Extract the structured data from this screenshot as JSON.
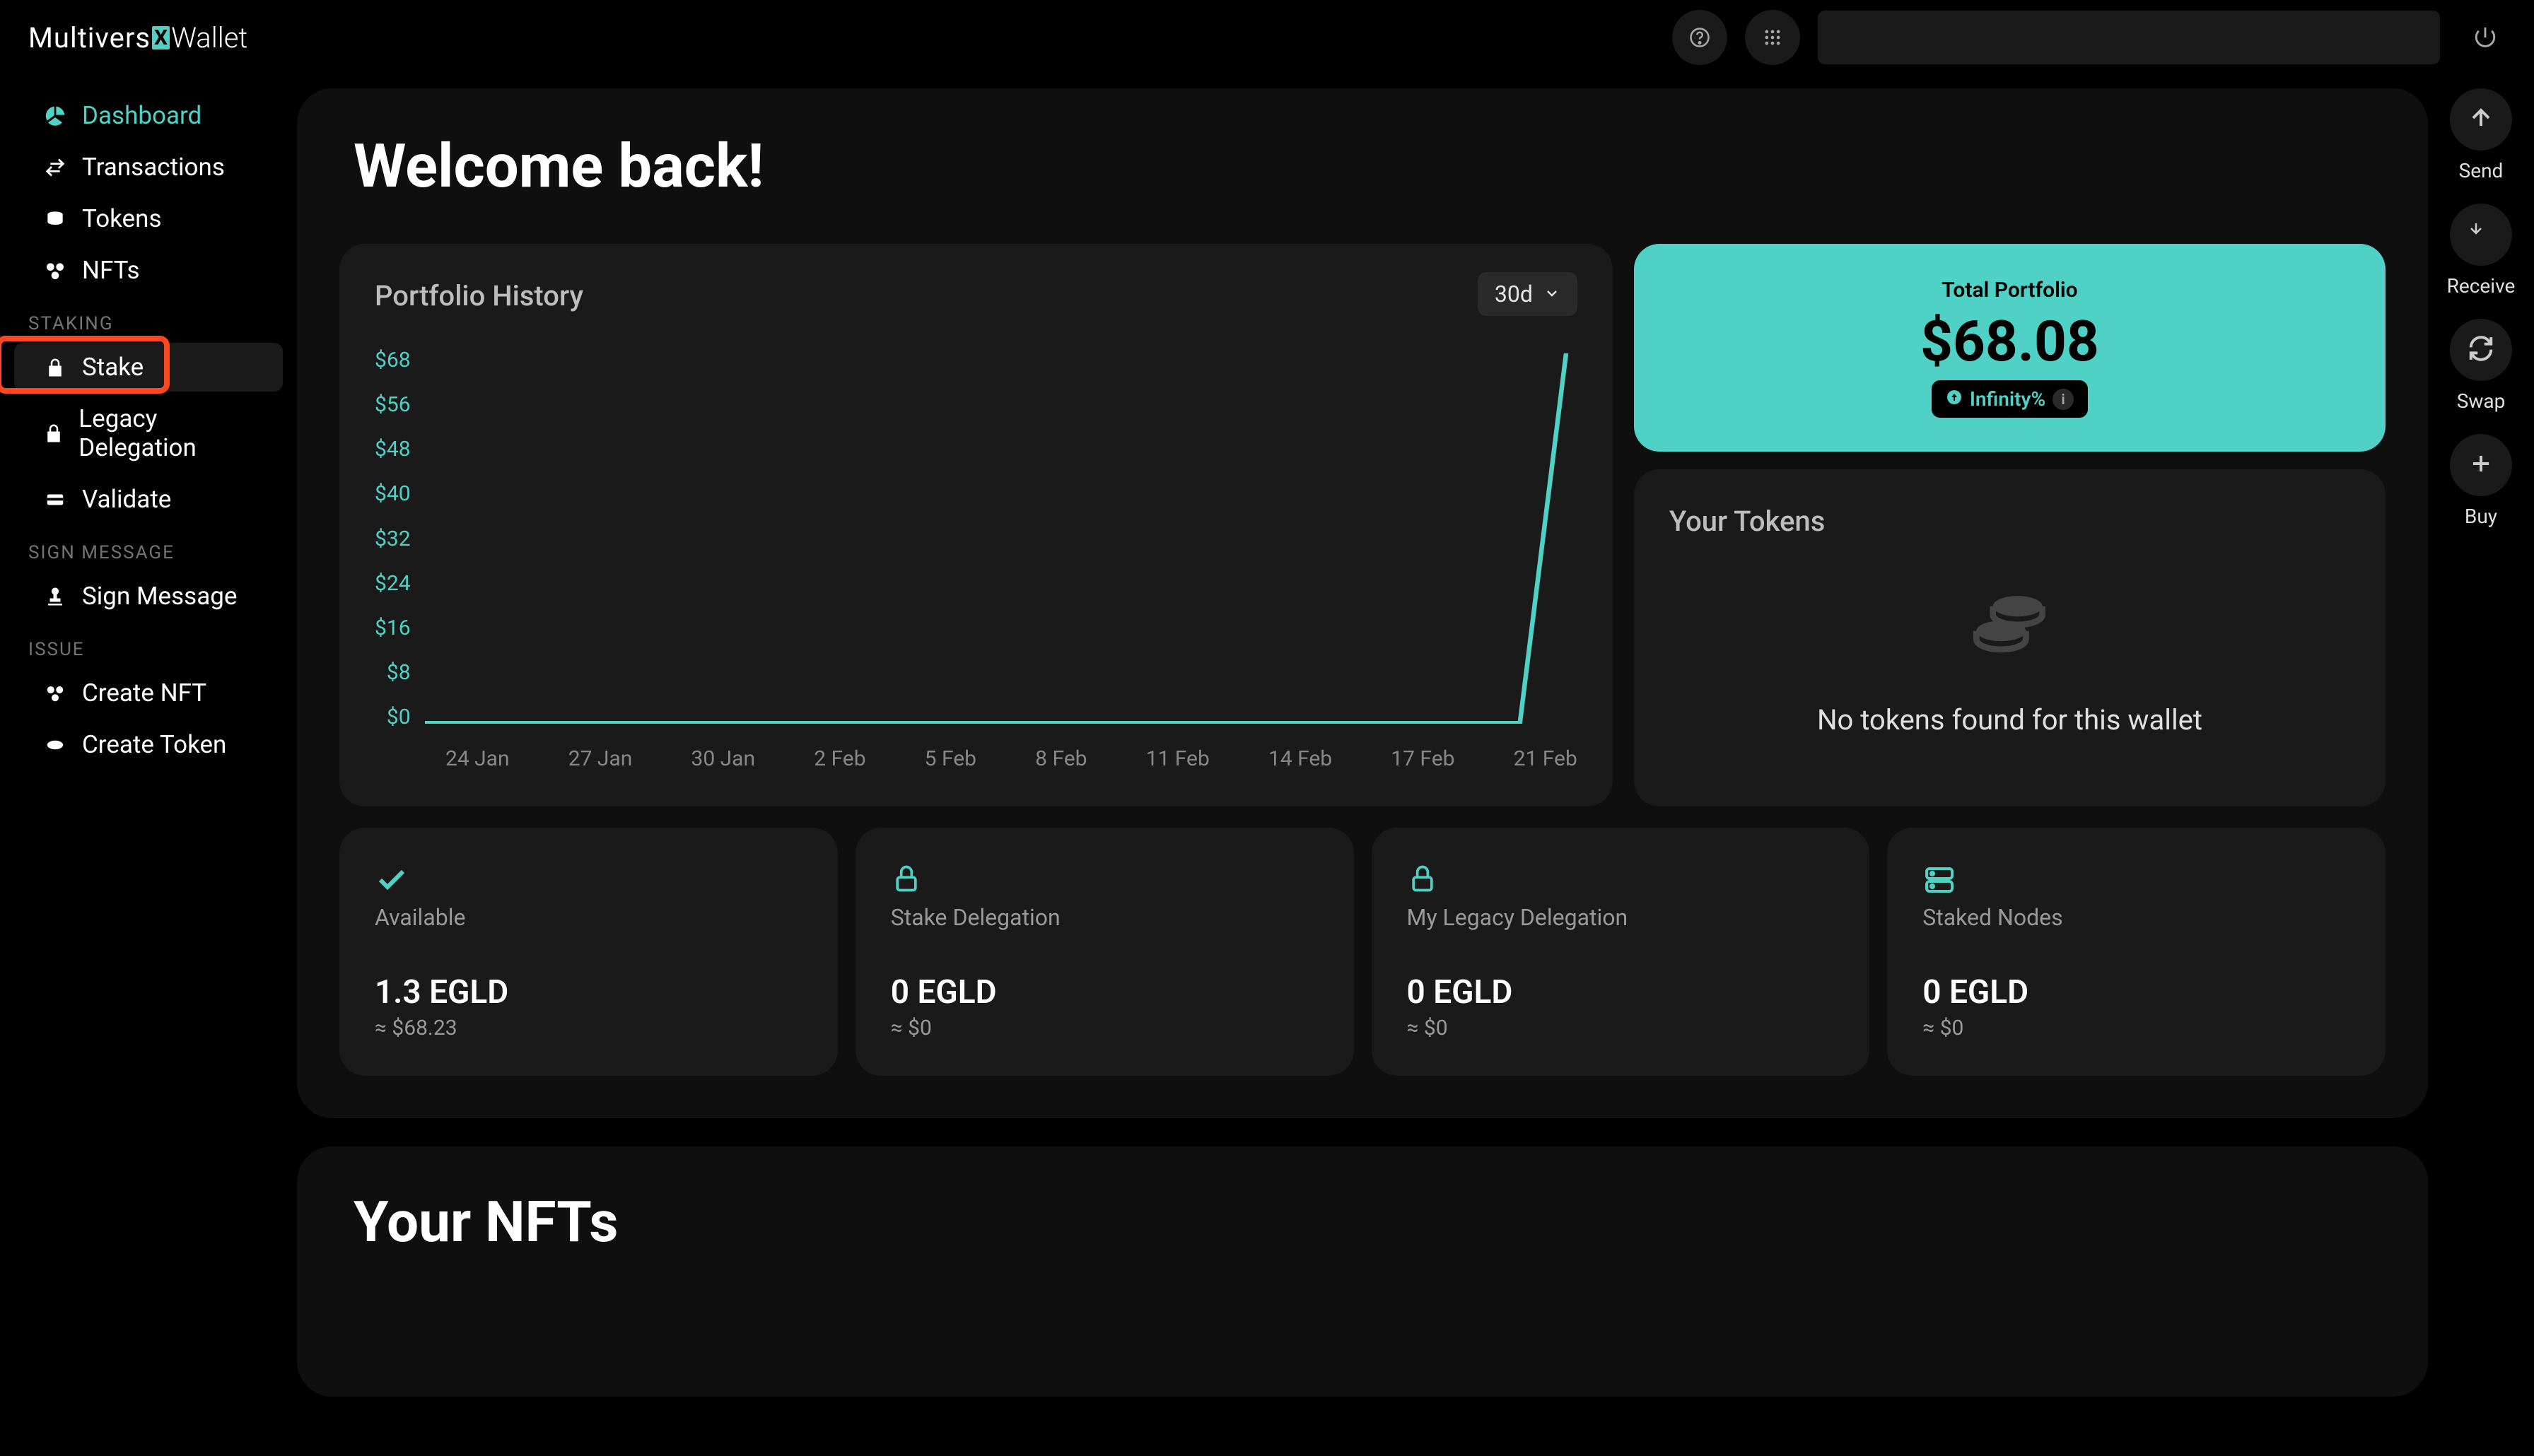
{
  "logo": {
    "part1": "Multivers",
    "part2": "X",
    "part3": "Wallet"
  },
  "sidebar": {
    "items": [
      {
        "label": "Dashboard",
        "icon": "pie"
      },
      {
        "label": "Transactions",
        "icon": "exchange"
      },
      {
        "label": "Tokens",
        "icon": "coins-mini"
      },
      {
        "label": "NFTs",
        "icon": "nft"
      }
    ],
    "section_staking": "STAKING",
    "staking": [
      {
        "label": "Stake",
        "icon": "lock"
      },
      {
        "label": "Legacy Delegation",
        "icon": "lock"
      },
      {
        "label": "Validate",
        "icon": "card"
      }
    ],
    "section_sign": "SIGN MESSAGE",
    "sign": [
      {
        "label": "Sign Message",
        "icon": "stamp"
      }
    ],
    "section_issue": "ISSUE",
    "issue": [
      {
        "label": "Create NFT",
        "icon": "nft"
      },
      {
        "label": "Create Token",
        "icon": "coin"
      }
    ]
  },
  "header": {
    "welcome": "Welcome back!"
  },
  "rail": {
    "send": "Send",
    "receive": "Receive",
    "swap": "Swap",
    "buy": "Buy"
  },
  "portfolio": {
    "title": "Portfolio History",
    "period": "30d",
    "total_label": "Total Portfolio",
    "total_value": "$68.08",
    "badge": "Infinity%"
  },
  "chart_data": {
    "type": "line",
    "title": "Portfolio History",
    "xlabel": "",
    "ylabel": "USD",
    "ylim": [
      0,
      68
    ],
    "y_ticks": [
      "$68",
      "$56",
      "$48",
      "$40",
      "$32",
      "$24",
      "$16",
      "$8",
      "$0"
    ],
    "categories": [
      "24 Jan",
      "27 Jan",
      "30 Jan",
      "2 Feb",
      "5 Feb",
      "8 Feb",
      "11 Feb",
      "14 Feb",
      "17 Feb",
      "21 Feb"
    ],
    "values": [
      0,
      0,
      0,
      0,
      0,
      0,
      0,
      0,
      0,
      68
    ]
  },
  "tokens": {
    "title": "Your Tokens",
    "empty": "No tokens found for this wallet"
  },
  "stats": [
    {
      "label": "Available",
      "value": "1.3 EGLD",
      "sub": "≈ $68.23",
      "icon": "check"
    },
    {
      "label": "Stake Delegation",
      "value": "0 EGLD",
      "sub": "≈ $0",
      "icon": "lock"
    },
    {
      "label": "My Legacy Delegation",
      "value": "0 EGLD",
      "sub": "≈ $0",
      "icon": "lock"
    },
    {
      "label": "Staked Nodes",
      "value": "0 EGLD",
      "sub": "≈ $0",
      "icon": "server"
    }
  ],
  "nfts": {
    "title": "Your NFTs"
  }
}
